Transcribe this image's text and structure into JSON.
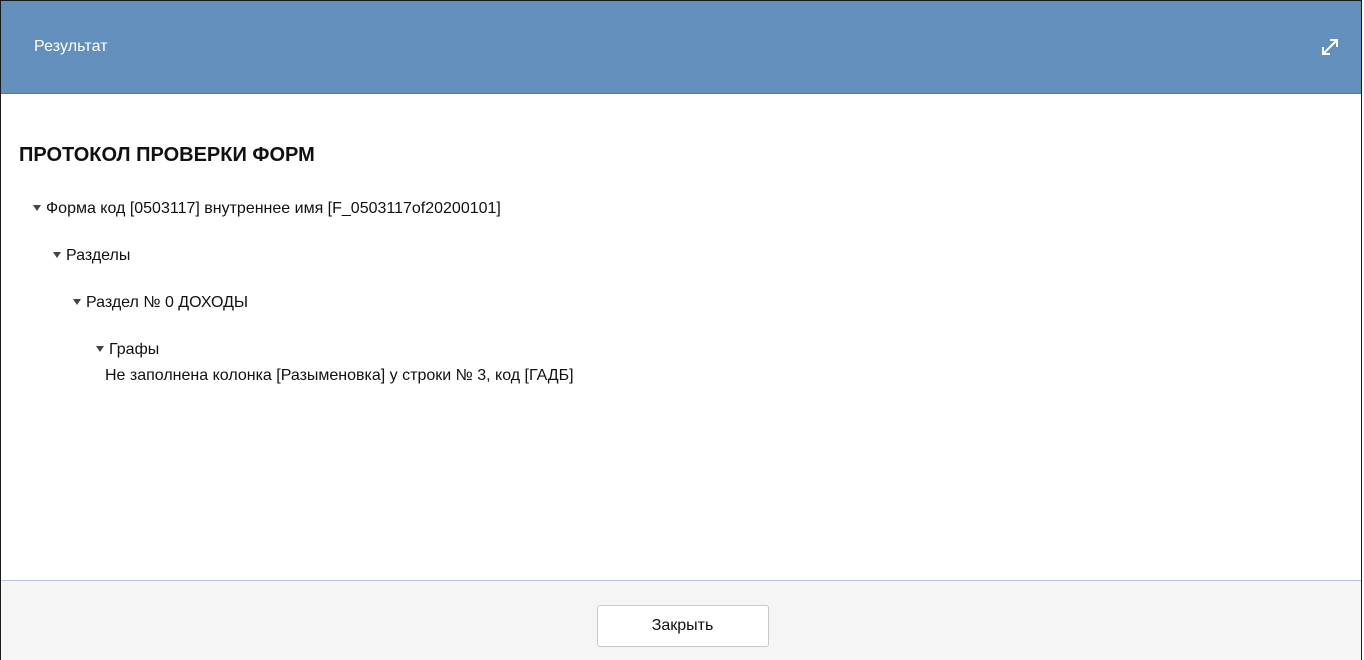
{
  "dialog": {
    "title": "Результат",
    "expand_icon": "expand-arrows-icon",
    "colors": {
      "titlebar": "#628fbc",
      "footer": "#f5f5f6"
    }
  },
  "report": {
    "heading": "ПРОТОКОЛ ПРОВЕРКИ ФОРМ",
    "tree": {
      "form_label": "Форма код [0503117] внутреннее имя [F_0503117of20200101]",
      "sections_label": "Разделы",
      "section_label": "Раздел № 0 ДОХОДЫ",
      "columns_label": "Графы",
      "message": "Не заполнена колонка [Разыменовка] у строки № 3, код [ГАДБ]"
    }
  },
  "footer": {
    "close_label": "Закрыть"
  }
}
